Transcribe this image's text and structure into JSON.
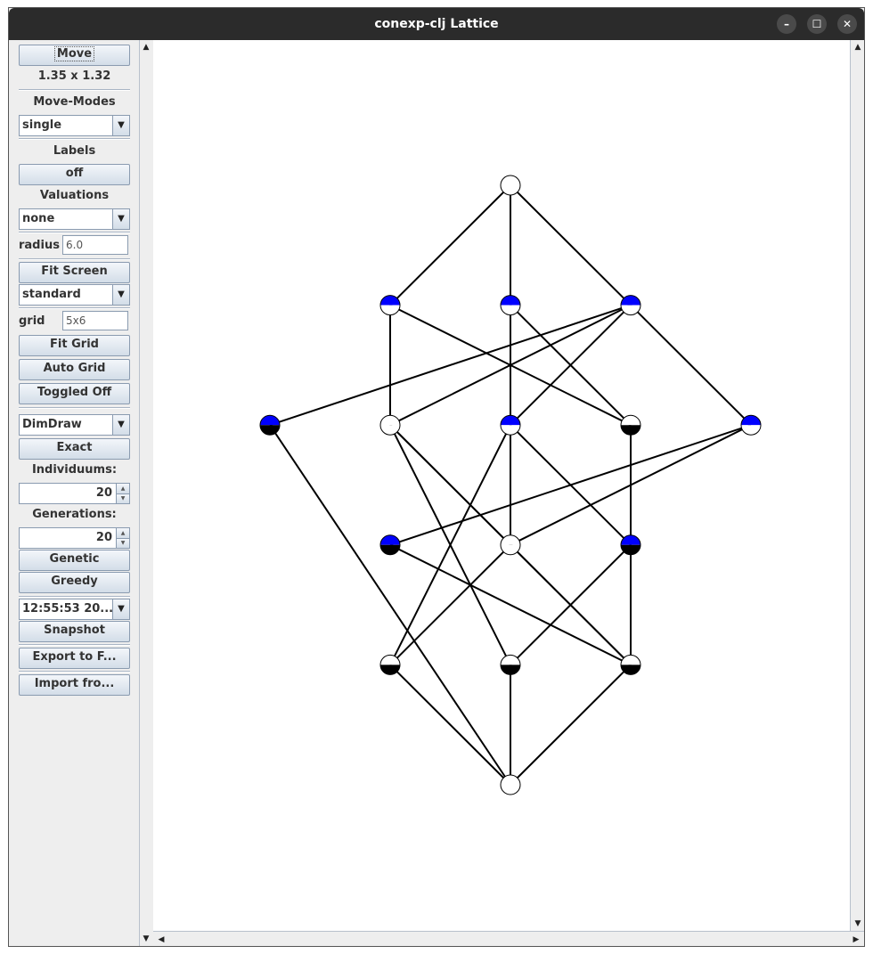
{
  "window": {
    "title": "conexp-clj Lattice",
    "controls": {
      "minimize": "–",
      "maximize": "☐",
      "close": "✕"
    }
  },
  "sidebar": {
    "move_button": "Move",
    "zoom_value": "1.35 x 1.32",
    "move_modes_label": "Move-Modes",
    "move_mode_value": "single",
    "labels_label": "Labels",
    "labels_toggle": "off",
    "valuations_label": "Valuations",
    "valuation_value": "none",
    "radius_label": "radius",
    "radius_value": "6.0",
    "fit_screen_button": "Fit Screen",
    "layout_value": "standard",
    "grid_label": "grid",
    "grid_value": "5x6",
    "fit_grid_button": "Fit Grid",
    "auto_grid_button": "Auto Grid",
    "toggled_button": "Toggled Off",
    "algorithm_value": "DimDraw",
    "exact_button": "Exact",
    "individuums_label": "Individuums:",
    "individuums_value": "20",
    "generations_label": "Generations:",
    "generations_value": "20",
    "genetic_button": "Genetic",
    "greedy_button": "Greedy",
    "snapshot_value": "12:55:53 20...",
    "snapshot_button": "Snapshot",
    "export_button": "Export to F...",
    "import_button": "Import fro..."
  },
  "colors": {
    "node_blue": "#0000ff",
    "node_black": "#000000",
    "node_white": "#ffffff",
    "edge": "#000000"
  },
  "lattice": {
    "nodes": [
      {
        "id": "top",
        "row": 0,
        "col": 2,
        "upper": "white",
        "lower": "white"
      },
      {
        "id": "a1",
        "row": 1,
        "col": 1,
        "upper": "blue",
        "lower": "white"
      },
      {
        "id": "a2",
        "row": 1,
        "col": 2,
        "upper": "blue",
        "lower": "white"
      },
      {
        "id": "a3",
        "row": 1,
        "col": 3,
        "upper": "blue",
        "lower": "white"
      },
      {
        "id": "b0",
        "row": 2,
        "col": 0,
        "upper": "blue",
        "lower": "black"
      },
      {
        "id": "b1",
        "row": 2,
        "col": 1,
        "upper": "white",
        "lower": "white"
      },
      {
        "id": "b2",
        "row": 2,
        "col": 2,
        "upper": "blue",
        "lower": "white"
      },
      {
        "id": "b3",
        "row": 2,
        "col": 3,
        "upper": "white",
        "lower": "black"
      },
      {
        "id": "b4",
        "row": 2,
        "col": 4,
        "upper": "blue",
        "lower": "white"
      },
      {
        "id": "c1",
        "row": 3,
        "col": 1,
        "upper": "blue",
        "lower": "black"
      },
      {
        "id": "c2",
        "row": 3,
        "col": 2,
        "upper": "white",
        "lower": "white"
      },
      {
        "id": "c3",
        "row": 3,
        "col": 3,
        "upper": "blue",
        "lower": "black"
      },
      {
        "id": "d1",
        "row": 4,
        "col": 1,
        "upper": "white",
        "lower": "black"
      },
      {
        "id": "d2",
        "row": 4,
        "col": 2,
        "upper": "white",
        "lower": "black"
      },
      {
        "id": "d3",
        "row": 4,
        "col": 3,
        "upper": "white",
        "lower": "black"
      },
      {
        "id": "bot",
        "row": 5,
        "col": 2,
        "upper": "white",
        "lower": "white"
      }
    ],
    "edges": [
      [
        "top",
        "a1"
      ],
      [
        "top",
        "a2"
      ],
      [
        "top",
        "a3"
      ],
      [
        "a1",
        "b1"
      ],
      [
        "a1",
        "b3"
      ],
      [
        "a2",
        "b2"
      ],
      [
        "a2",
        "b3"
      ],
      [
        "a3",
        "b0"
      ],
      [
        "a3",
        "b1"
      ],
      [
        "a3",
        "b2"
      ],
      [
        "a3",
        "b4"
      ],
      [
        "b0",
        "bot"
      ],
      [
        "b1",
        "c2"
      ],
      [
        "b1",
        "d2"
      ],
      [
        "b1",
        "d3"
      ],
      [
        "b2",
        "c2"
      ],
      [
        "b2",
        "c3"
      ],
      [
        "b2",
        "d1"
      ],
      [
        "b3",
        "c3"
      ],
      [
        "b4",
        "c1"
      ],
      [
        "b4",
        "c2"
      ],
      [
        "c1",
        "d3"
      ],
      [
        "c2",
        "d1"
      ],
      [
        "c2",
        "d3"
      ],
      [
        "c3",
        "d2"
      ],
      [
        "c3",
        "d3"
      ],
      [
        "c1",
        "c1"
      ],
      [
        "d1",
        "bot"
      ],
      [
        "d2",
        "bot"
      ],
      [
        "d3",
        "bot"
      ]
    ]
  }
}
